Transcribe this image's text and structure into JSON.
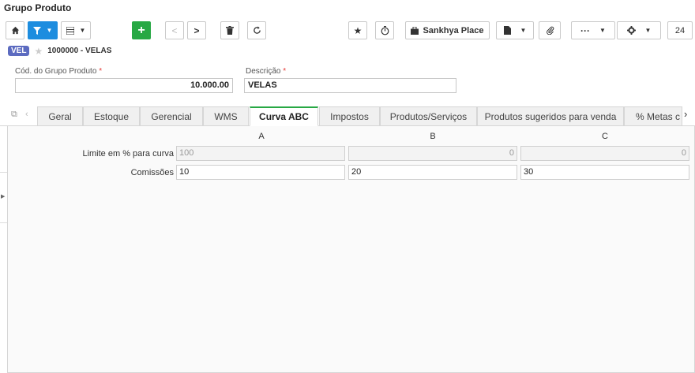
{
  "window": {
    "title": "Grupo Produto"
  },
  "toolbar": {
    "home_icon": "home-icon",
    "filter_icon": "filter-icon",
    "grid_icon": "grid-icon",
    "add_label": "+",
    "prev_icon": "<",
    "next_icon": ">",
    "delete_icon": "trash-icon",
    "refresh_icon": "refresh-icon",
    "star_icon": "★",
    "timer_icon": "timer-icon",
    "place_label": "Sankhya Place",
    "more_label": "···",
    "page_number": "24"
  },
  "record": {
    "tag": "VEL",
    "label": "1000000 - VELAS"
  },
  "form": {
    "code_label": "Cód. do Grupo Produto",
    "code_value": "10.000.00",
    "desc_label": "Descrição",
    "desc_value": "VELAS",
    "required_mark": "*"
  },
  "tabs": [
    "Geral",
    "Estoque",
    "Gerencial",
    "WMS",
    "Curva ABC",
    "Impostos",
    "Produtos/Serviços",
    "Produtos sugeridos para venda",
    "% Metas c"
  ],
  "active_tab": "Curva ABC",
  "curva": {
    "columns": [
      "A",
      "B",
      "C"
    ],
    "rows": [
      {
        "label": "Limite em % para curva",
        "values": [
          "100",
          "0",
          "0"
        ]
      },
      {
        "label": "Comissões",
        "values": [
          "10",
          "20",
          "30"
        ]
      }
    ]
  },
  "colors": {
    "accent": "#1d8ddf",
    "add": "#27a844",
    "tag": "#5c6bc0",
    "required": "#e53935"
  }
}
